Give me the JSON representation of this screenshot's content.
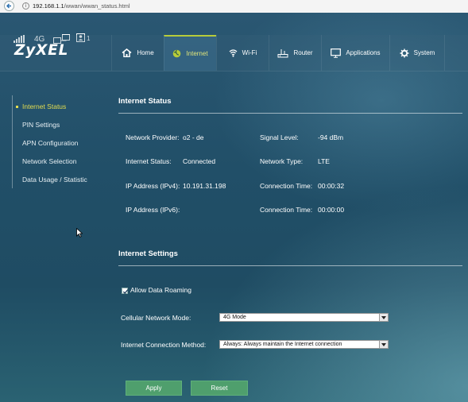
{
  "browser": {
    "url_host": "192.168.1.1",
    "url_path": "/wwan/wwan_status.html"
  },
  "status_bar": {
    "network_type": "4G",
    "user_count": "1"
  },
  "header": {
    "logo": "ZyXEL",
    "nav": [
      {
        "label": "Home",
        "icon": "home-icon"
      },
      {
        "label": "Internet",
        "icon": "globe-icon",
        "active": true
      },
      {
        "label": "Wi-Fi",
        "icon": "wifi-icon"
      },
      {
        "label": "Router",
        "icon": "router-icon"
      },
      {
        "label": "Applications",
        "icon": "monitor-icon"
      },
      {
        "label": "System",
        "icon": "gear-icon"
      }
    ]
  },
  "sidebar": {
    "items": [
      {
        "label": "Internet Status",
        "active": true
      },
      {
        "label": "PIN Settings"
      },
      {
        "label": "APN Configuration"
      },
      {
        "label": "Network Selection"
      },
      {
        "label": "Data Usage / Statistic"
      }
    ]
  },
  "internet_status": {
    "title": "Internet Status",
    "left": [
      {
        "label": "Network Provider:",
        "value": "o2 - de"
      },
      {
        "label": "Internet Status:",
        "value": "Connected"
      },
      {
        "label": "IP Address (IPv4):",
        "value": "10.191.31.198"
      },
      {
        "label": "IP Address (IPv6):",
        "value": ""
      }
    ],
    "right": [
      {
        "label": "Signal Level:",
        "value": "-94 dBm"
      },
      {
        "label": "Network Type:",
        "value": "LTE"
      },
      {
        "label": "Connection Time:",
        "value": "00:00:32"
      },
      {
        "label": "Connection Time:",
        "value": "00:00:00"
      }
    ]
  },
  "internet_settings": {
    "title": "Internet Settings",
    "allow_roaming_label": "Allow Data Roaming",
    "allow_roaming_checked": true,
    "network_mode_label": "Cellular Network Mode:",
    "network_mode_value": "4G Mode",
    "connection_method_label": "Internet Connection Method:",
    "connection_method_value": "Always: Always maintain the Internet connection"
  },
  "buttons": {
    "apply": "Apply",
    "reset": "Reset"
  },
  "colors": {
    "accent_yellow": "#e3dc4f",
    "nav_active_border": "#b7cc3a",
    "button_green": "#4f9f6d",
    "background": "#1f4d68"
  }
}
